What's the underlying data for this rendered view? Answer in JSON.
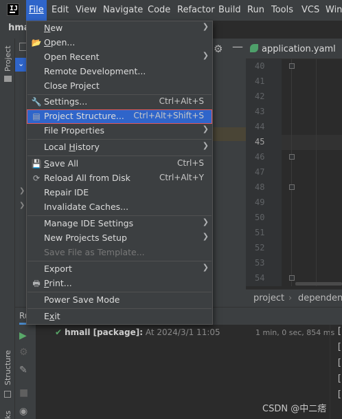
{
  "menubar": {
    "items": [
      {
        "label": "File"
      },
      {
        "label": "Edit"
      },
      {
        "label": "View"
      },
      {
        "label": "Navigate"
      },
      {
        "label": "Code"
      },
      {
        "label": "Refactor"
      },
      {
        "label": "Build"
      },
      {
        "label": "Run"
      },
      {
        "label": "Tools"
      },
      {
        "label": "VCS"
      },
      {
        "label": "Win"
      }
    ],
    "logo_text": "IJ"
  },
  "project": {
    "title": "hma",
    "strip_label": "Project",
    "structure_label": "Structure",
    "bookmarks_label": "ks"
  },
  "file_menu": {
    "items": [
      {
        "label": "New",
        "mnemonic": "N",
        "rest": "ew"
      },
      {
        "label": "Open...",
        "mnemonic": "O",
        "rest": "pen..."
      },
      {
        "label": "Open Recent"
      },
      {
        "label": "Remote Development..."
      },
      {
        "label": "Close Project"
      },
      {
        "label": "Settings...",
        "shortcut": "Ctrl+Alt+S"
      },
      {
        "label": "Project Structure...",
        "shortcut": "Ctrl+Alt+Shift+S"
      },
      {
        "label": "File Properties"
      },
      {
        "label": "Local History",
        "mnemonic": "H",
        "before": "Local ",
        "rest": "istory"
      },
      {
        "label": "Save All",
        "mnemonic": "S",
        "rest": "ave All",
        "shortcut": "Ctrl+S"
      },
      {
        "label": "Reload All from Disk",
        "shortcut": "Ctrl+Alt+Y"
      },
      {
        "label": "Repair IDE"
      },
      {
        "label": "Invalidate Caches..."
      },
      {
        "label": "Manage IDE Settings"
      },
      {
        "label": "New Projects Setup"
      },
      {
        "label": "Save File as Template..."
      },
      {
        "label": "Export"
      },
      {
        "label": "Print...",
        "mnemonic": "P",
        "rest": "rint..."
      },
      {
        "label": "Power Save Mode"
      },
      {
        "label": "Exit",
        "mnemonic": "x",
        "before": "E",
        "rest": "it"
      }
    ]
  },
  "editor": {
    "tab_label": "application.yaml",
    "line_numbers": [
      "40",
      "41",
      "42",
      "43",
      "44",
      "45",
      "46",
      "47",
      "48",
      "49",
      "50",
      "51",
      "52",
      "53",
      "54"
    ],
    "current_line": "45",
    "breadcrumb": {
      "project": "project",
      "separator": "›",
      "dependencies": "dependencie"
    }
  },
  "run_panel": {
    "tab_label": "Ru",
    "entry_name": "hmall [package]:",
    "entry_when": "At 2024/3/1 11:05",
    "entry_time": "1 min, 0 sec, 854 ms",
    "console_bracket": "["
  },
  "watermark": "CSDN @中二痞",
  "colors": {
    "menu_bg": "#3c3f41",
    "highlight": "#2f65ca",
    "highlight_border": "#e0585a",
    "success": "#59a869",
    "editor_bg": "#2b2b2b"
  }
}
